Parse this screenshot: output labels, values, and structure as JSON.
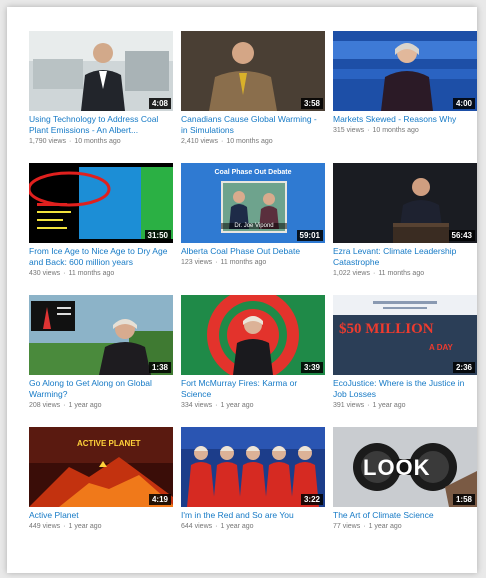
{
  "videos": [
    {
      "title": "Using Technology to Address Coal Plant Emissions - An Albert...",
      "views": "1,790 views",
      "age": "10 months ago",
      "duration": "4:08"
    },
    {
      "title": "Canadians Cause Global Warming - in Simulations",
      "views": "2,410 views",
      "age": "10 months ago",
      "duration": "3:58"
    },
    {
      "title": "Markets Skewed - Reasons Why",
      "views": "315 views",
      "age": "10 months ago",
      "duration": "4:00"
    },
    {
      "title": "From Ice Age to Nice Age to Dry Age and Back: 600 million years",
      "views": "430 views",
      "age": "11 months ago",
      "duration": "31:50"
    },
    {
      "title": "Alberta Coal Phase Out Debate",
      "views": "123 views",
      "age": "11 months ago",
      "duration": "59:01",
      "overlay_title": "Coal Phase Out Debate",
      "overlay_caption": "Dr. Joe Vipond"
    },
    {
      "title": "Ezra Levant: Climate Leadership Catastrophe",
      "views": "1,022 views",
      "age": "11 months ago",
      "duration": "56:43"
    },
    {
      "title": "Go Along to Get Along on Global Warming?",
      "views": "208 views",
      "age": "1 year ago",
      "duration": "1:38"
    },
    {
      "title": "Fort McMurray Fires: Karma or Science",
      "views": "334 views",
      "age": "1 year ago",
      "duration": "3:39"
    },
    {
      "title": "EcoJustice: Where is the Justice in Job Losses",
      "views": "391 views",
      "age": "1 year ago",
      "duration": "2:36",
      "overlay_big": "$50 MILLION",
      "overlay_small": "A DAY"
    },
    {
      "title": "Active Planet",
      "views": "449 views",
      "age": "1 year ago",
      "duration": "4:19",
      "overlay_title": "ACTIVE PLANET"
    },
    {
      "title": "I'm in the Red and So are You",
      "views": "644 views",
      "age": "1 year ago",
      "duration": "3:22"
    },
    {
      "title": "The Art of Climate Science",
      "views": "77 views",
      "age": "1 year ago",
      "duration": "1:58",
      "overlay_big": "LOOK"
    }
  ],
  "colors": {
    "title_link": "#167ac6",
    "meta": "#767676",
    "card": "#ffffff"
  }
}
